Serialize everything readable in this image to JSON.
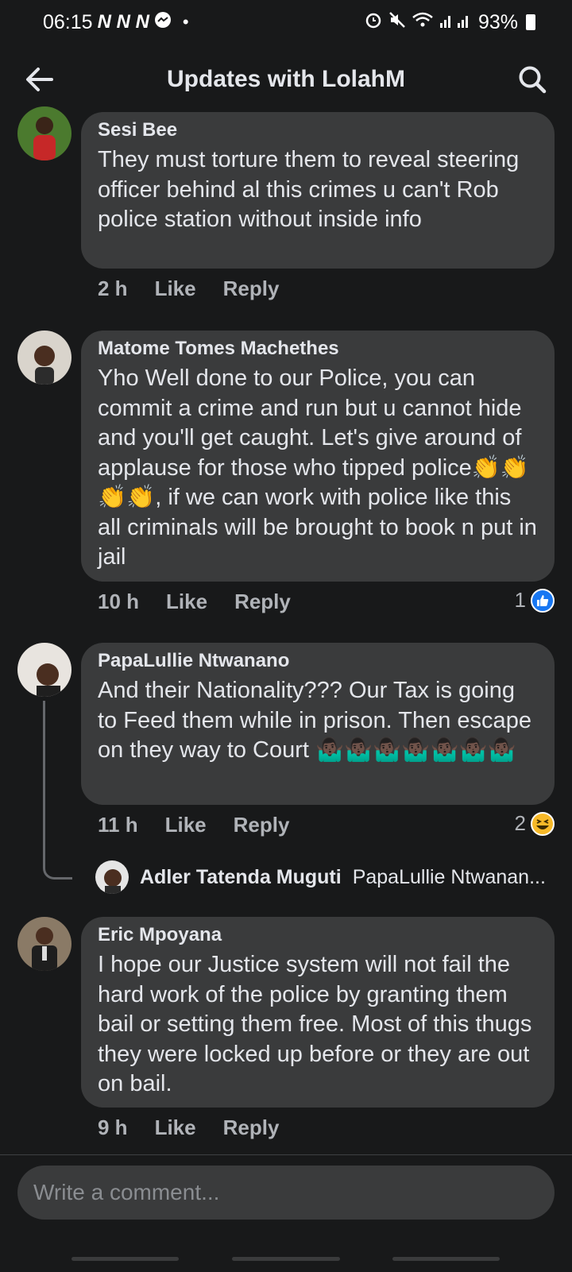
{
  "status_bar": {
    "time": "06:15",
    "notification_glyphs": "N N N",
    "battery": "93%"
  },
  "header": {
    "title": "Updates with LolahM"
  },
  "comments": [
    {
      "author": "Sesi Bee",
      "text": "They must torture them to reveal steering officer behind al this crimes u can't Rob police station without inside info",
      "time": "2 h",
      "like": "Like",
      "reply": "Reply"
    },
    {
      "author": "Matome Tomes Machethes",
      "text": "Yho Well done to our Police, you can commit a crime and run but u cannot hide and you'll get caught. Let's give around of applause for those who tipped police👏👏👏👏, if we can work with police like this all criminals will be brought to book n put in jail",
      "time": "10 h",
      "like": "Like",
      "reply": "Reply",
      "reaction_count": "1"
    },
    {
      "author": "PapaLullie Ntwanano",
      "text": "And their Nationality??? Our Tax is going to Feed them while in prison. Then escape on they way to Court 🤷🏿‍♂️🤷🏿‍♂️🤷🏿‍♂️🤷🏿‍♂️🤷🏿‍♂️🤷🏿‍♂️🤷🏿‍♂️",
      "time": "11 h",
      "like": "Like",
      "reply": "Reply",
      "reaction_count": "2"
    },
    {
      "author": "Eric Mpoyana",
      "text": "I hope our Justice system will not fail the hard work of the police by granting them bail or setting them free. Most of this thugs they were locked up before or they are out on bail.",
      "time": "9 h",
      "like": "Like",
      "reply": "Reply"
    }
  ],
  "reply_preview": {
    "author": "Adler Tatenda Muguti",
    "text": "PapaLullie Ntwanan..."
  },
  "composer": {
    "placeholder": "Write a comment..."
  },
  "icons": {
    "back": "arrow-left-icon",
    "search": "search-icon",
    "like_reaction": "thumbs-up-icon",
    "haha_reaction": "laughing-face-icon"
  },
  "colors": {
    "background": "#18191a",
    "bubble": "#3a3b3c",
    "primary_text": "#e4e6eb",
    "secondary_text": "#b0b3b8",
    "like_blue": "#1877f2"
  }
}
